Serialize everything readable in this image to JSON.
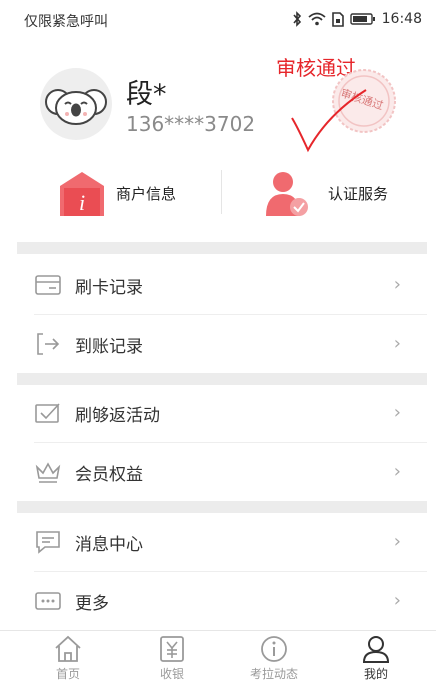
{
  "status_bar": {
    "carrier_text": "仅限紧急呼叫",
    "time": "16:48"
  },
  "profile": {
    "name": "段*",
    "phone": "136****3702",
    "audit_text": "审核通过",
    "stamp_text": "审核通过"
  },
  "quick_actions": [
    {
      "label": "商户信息",
      "icon": "merchant-info-icon"
    },
    {
      "label": "认证服务",
      "icon": "certification-user-icon"
    }
  ],
  "menu": {
    "group1": [
      {
        "label": "刷卡记录",
        "icon": "card-icon"
      },
      {
        "label": "到账记录",
        "icon": "arrival-icon"
      }
    ],
    "group2": [
      {
        "label": "刷够返活动",
        "icon": "checkbox-activity-icon"
      },
      {
        "label": "会员权益",
        "icon": "crown-icon"
      }
    ],
    "group3": [
      {
        "label": "消息中心",
        "icon": "message-icon"
      },
      {
        "label": "更多",
        "icon": "more-icon"
      }
    ],
    "arrow": "›"
  },
  "tab_bar": [
    {
      "label": "首页",
      "icon": "home-icon"
    },
    {
      "label": "收银",
      "icon": "cashier-icon"
    },
    {
      "label": "考拉动态",
      "icon": "info-icon"
    },
    {
      "label": "我的",
      "icon": "person-icon",
      "active": true
    }
  ],
  "colors": {
    "accent_red": "#e6262b",
    "icon_red": "#f06a6f",
    "gray_text": "#8a8a8a"
  }
}
